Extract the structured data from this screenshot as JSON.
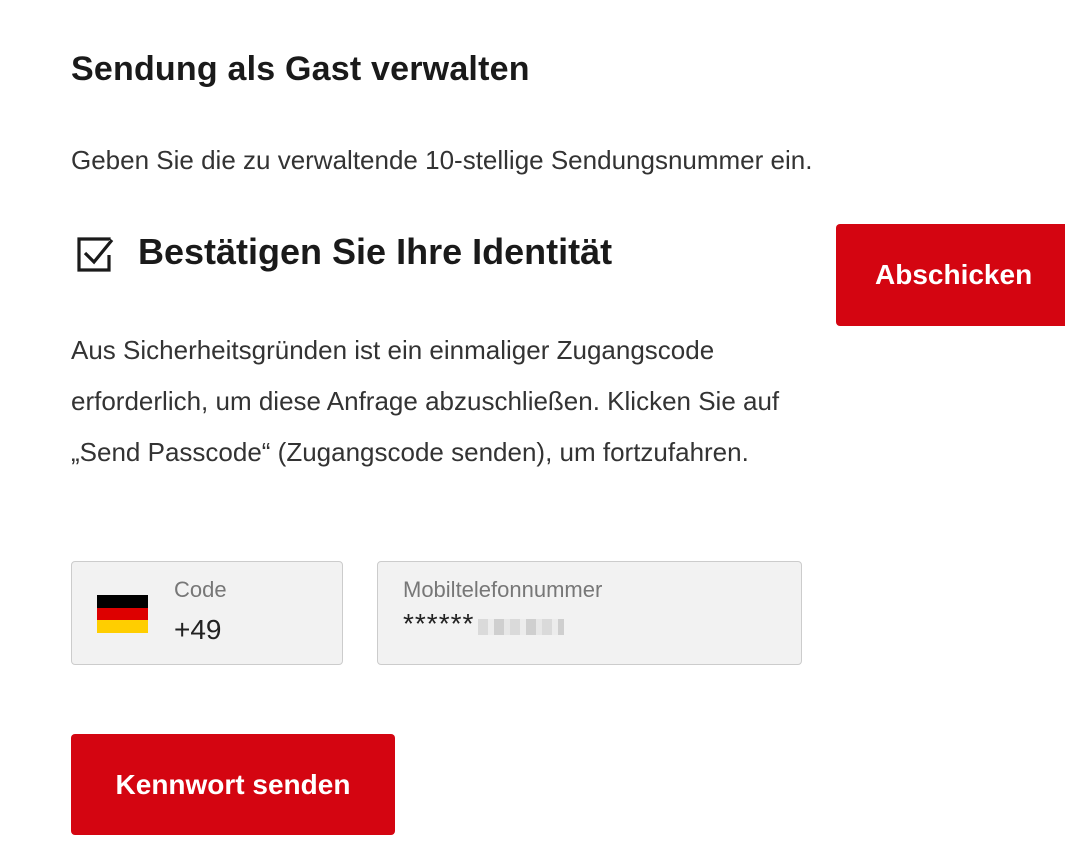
{
  "page": {
    "title": "Sendung als Gast verwalten",
    "intro": "Geben Sie die zu verwaltende 10-stellige Sendungsnummer ein."
  },
  "identity": {
    "heading": "Bestätigen Sie Ihre Identität",
    "icon": "checkbox-checked-icon",
    "security_text": "Aus Sicherheitsgründen ist ein einmaliger Zugangscode erforderlich, um diese Anfrage abzuschließen. Klicken Sie auf „Send Passcode“ (Zugangscode senden), um fortzufahren."
  },
  "actions": {
    "submit_label": "Abschicken",
    "send_label": "Kennwort senden"
  },
  "form": {
    "code": {
      "label": "Code",
      "value": "+49",
      "flag": "germany-flag-icon"
    },
    "phone": {
      "label": "Mobiltelefonnummer",
      "value": "******"
    }
  },
  "colors": {
    "primary": "#d40511",
    "field_bg": "#f2f2f2",
    "text": "#1a1a1a"
  }
}
